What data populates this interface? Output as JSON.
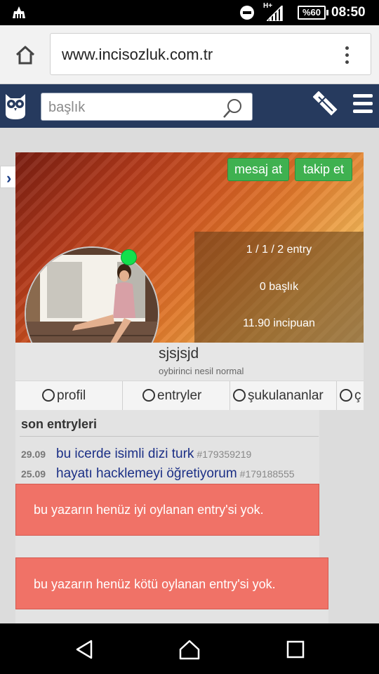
{
  "statusbar": {
    "network": "H+",
    "battery": "%60",
    "time": "08:50"
  },
  "browser": {
    "url": "www.incisozluk.com.tr"
  },
  "header": {
    "search_placeholder": "başlık"
  },
  "profile": {
    "actions": {
      "message": "mesaj at",
      "follow": "takip et"
    },
    "stats": {
      "entries": "1 / 1 / 2 entry",
      "titles": "0 başlık",
      "points": "11.90 incipuan"
    },
    "username": "sjsjsjd",
    "user_title": "oybirinci nesil normal",
    "online_color": "#12e04c",
    "tabs": [
      {
        "label": "profil"
      },
      {
        "label": "entryler"
      },
      {
        "label": "şukulananlar"
      },
      {
        "label": "ç"
      }
    ]
  },
  "recent": {
    "title": "son entryleri",
    "entries": [
      {
        "date": "29.09",
        "title": "bu icerde isimli dizi turk",
        "id": "#179359219"
      },
      {
        "date": "25.09",
        "title": "hayatı hacklemeyi öğretiyorum",
        "id": "#179188555"
      }
    ]
  },
  "alerts": {
    "good": "bu yazarın henüz iyi oylanan entry'si yok.",
    "bad": "bu yazarın henüz kötü oylanan entry'si yok."
  },
  "colors": {
    "header_bg": "#263a5e",
    "button_green": "#3fb150",
    "alert_red": "#f07267",
    "link_blue": "#1b2f86"
  }
}
